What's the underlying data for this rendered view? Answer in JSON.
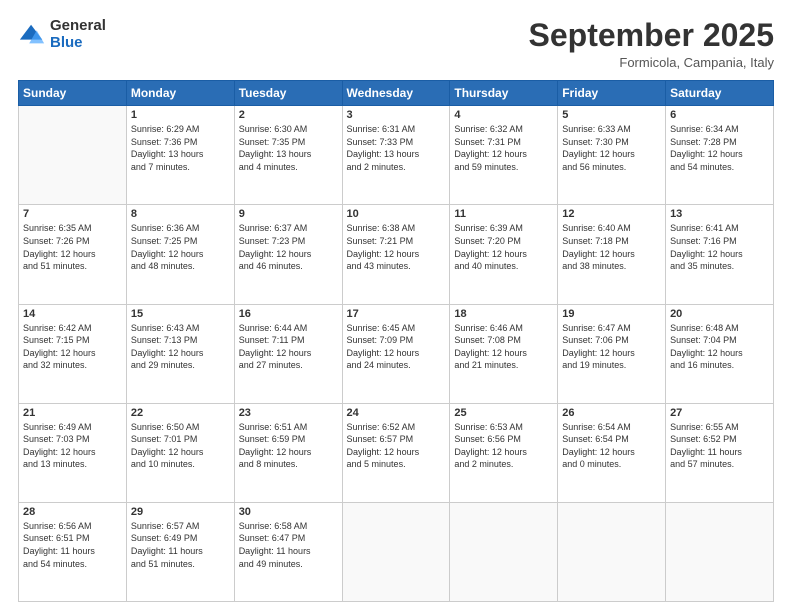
{
  "logo": {
    "general": "General",
    "blue": "Blue"
  },
  "header": {
    "month": "September 2025",
    "location": "Formicola, Campania, Italy"
  },
  "weekdays": [
    "Sunday",
    "Monday",
    "Tuesday",
    "Wednesday",
    "Thursday",
    "Friday",
    "Saturday"
  ],
  "weeks": [
    [
      {
        "day": "",
        "info": ""
      },
      {
        "day": "1",
        "info": "Sunrise: 6:29 AM\nSunset: 7:36 PM\nDaylight: 13 hours\nand 7 minutes."
      },
      {
        "day": "2",
        "info": "Sunrise: 6:30 AM\nSunset: 7:35 PM\nDaylight: 13 hours\nand 4 minutes."
      },
      {
        "day": "3",
        "info": "Sunrise: 6:31 AM\nSunset: 7:33 PM\nDaylight: 13 hours\nand 2 minutes."
      },
      {
        "day": "4",
        "info": "Sunrise: 6:32 AM\nSunset: 7:31 PM\nDaylight: 12 hours\nand 59 minutes."
      },
      {
        "day": "5",
        "info": "Sunrise: 6:33 AM\nSunset: 7:30 PM\nDaylight: 12 hours\nand 56 minutes."
      },
      {
        "day": "6",
        "info": "Sunrise: 6:34 AM\nSunset: 7:28 PM\nDaylight: 12 hours\nand 54 minutes."
      }
    ],
    [
      {
        "day": "7",
        "info": "Sunrise: 6:35 AM\nSunset: 7:26 PM\nDaylight: 12 hours\nand 51 minutes."
      },
      {
        "day": "8",
        "info": "Sunrise: 6:36 AM\nSunset: 7:25 PM\nDaylight: 12 hours\nand 48 minutes."
      },
      {
        "day": "9",
        "info": "Sunrise: 6:37 AM\nSunset: 7:23 PM\nDaylight: 12 hours\nand 46 minutes."
      },
      {
        "day": "10",
        "info": "Sunrise: 6:38 AM\nSunset: 7:21 PM\nDaylight: 12 hours\nand 43 minutes."
      },
      {
        "day": "11",
        "info": "Sunrise: 6:39 AM\nSunset: 7:20 PM\nDaylight: 12 hours\nand 40 minutes."
      },
      {
        "day": "12",
        "info": "Sunrise: 6:40 AM\nSunset: 7:18 PM\nDaylight: 12 hours\nand 38 minutes."
      },
      {
        "day": "13",
        "info": "Sunrise: 6:41 AM\nSunset: 7:16 PM\nDaylight: 12 hours\nand 35 minutes."
      }
    ],
    [
      {
        "day": "14",
        "info": "Sunrise: 6:42 AM\nSunset: 7:15 PM\nDaylight: 12 hours\nand 32 minutes."
      },
      {
        "day": "15",
        "info": "Sunrise: 6:43 AM\nSunset: 7:13 PM\nDaylight: 12 hours\nand 29 minutes."
      },
      {
        "day": "16",
        "info": "Sunrise: 6:44 AM\nSunset: 7:11 PM\nDaylight: 12 hours\nand 27 minutes."
      },
      {
        "day": "17",
        "info": "Sunrise: 6:45 AM\nSunset: 7:09 PM\nDaylight: 12 hours\nand 24 minutes."
      },
      {
        "day": "18",
        "info": "Sunrise: 6:46 AM\nSunset: 7:08 PM\nDaylight: 12 hours\nand 21 minutes."
      },
      {
        "day": "19",
        "info": "Sunrise: 6:47 AM\nSunset: 7:06 PM\nDaylight: 12 hours\nand 19 minutes."
      },
      {
        "day": "20",
        "info": "Sunrise: 6:48 AM\nSunset: 7:04 PM\nDaylight: 12 hours\nand 16 minutes."
      }
    ],
    [
      {
        "day": "21",
        "info": "Sunrise: 6:49 AM\nSunset: 7:03 PM\nDaylight: 12 hours\nand 13 minutes."
      },
      {
        "day": "22",
        "info": "Sunrise: 6:50 AM\nSunset: 7:01 PM\nDaylight: 12 hours\nand 10 minutes."
      },
      {
        "day": "23",
        "info": "Sunrise: 6:51 AM\nSunset: 6:59 PM\nDaylight: 12 hours\nand 8 minutes."
      },
      {
        "day": "24",
        "info": "Sunrise: 6:52 AM\nSunset: 6:57 PM\nDaylight: 12 hours\nand 5 minutes."
      },
      {
        "day": "25",
        "info": "Sunrise: 6:53 AM\nSunset: 6:56 PM\nDaylight: 12 hours\nand 2 minutes."
      },
      {
        "day": "26",
        "info": "Sunrise: 6:54 AM\nSunset: 6:54 PM\nDaylight: 12 hours\nand 0 minutes."
      },
      {
        "day": "27",
        "info": "Sunrise: 6:55 AM\nSunset: 6:52 PM\nDaylight: 11 hours\nand 57 minutes."
      }
    ],
    [
      {
        "day": "28",
        "info": "Sunrise: 6:56 AM\nSunset: 6:51 PM\nDaylight: 11 hours\nand 54 minutes."
      },
      {
        "day": "29",
        "info": "Sunrise: 6:57 AM\nSunset: 6:49 PM\nDaylight: 11 hours\nand 51 minutes."
      },
      {
        "day": "30",
        "info": "Sunrise: 6:58 AM\nSunset: 6:47 PM\nDaylight: 11 hours\nand 49 minutes."
      },
      {
        "day": "",
        "info": ""
      },
      {
        "day": "",
        "info": ""
      },
      {
        "day": "",
        "info": ""
      },
      {
        "day": "",
        "info": ""
      }
    ]
  ]
}
